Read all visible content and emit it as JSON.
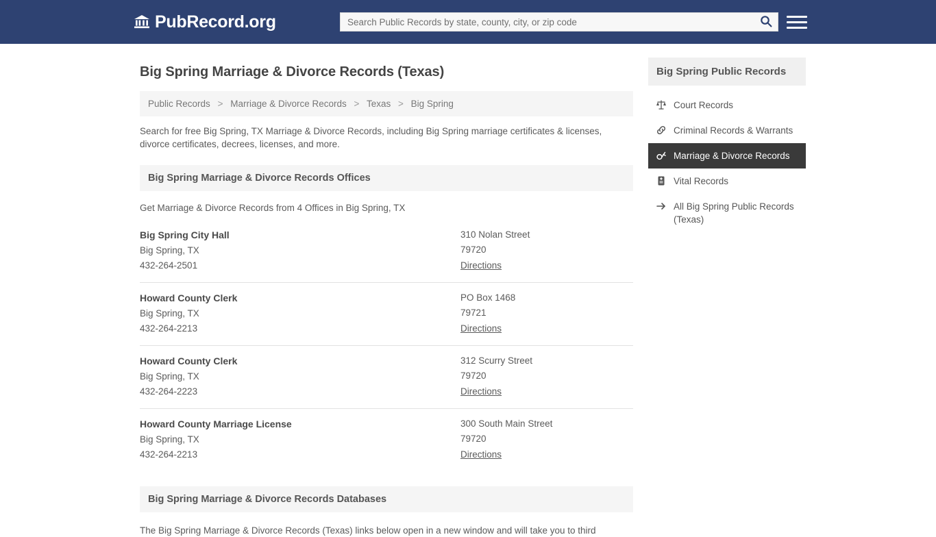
{
  "header": {
    "brand_icon": "bank-icon",
    "brand": "PubRecord.org",
    "search_placeholder": "Search Public Records by state, county, city, or zip code",
    "search_value": "",
    "search_icon": "search-icon",
    "menu_icon": "hamburger-menu-icon"
  },
  "page": {
    "title": "Big Spring Marriage & Divorce Records (Texas)"
  },
  "breadcrumb": [
    "Public Records",
    "Marriage & Divorce Records",
    "Texas",
    "Big Spring"
  ],
  "breadcrumb_separator": ">",
  "intro": "Search for free Big Spring, TX Marriage & Divorce Records, including Big Spring marriage certificates & licenses, divorce certificates, decrees, licenses, and more.",
  "offices_section": {
    "heading": "Big Spring Marriage & Divorce Records Offices",
    "subheading": "Get Marriage & Divorce Records from 4 Offices in Big Spring, TX",
    "directions_label": "Directions",
    "items": [
      {
        "name": "Big Spring City Hall",
        "city": "Big Spring, TX",
        "phone": "432-264-2501",
        "address": "310 Nolan Street",
        "zip": "79720"
      },
      {
        "name": "Howard County Clerk",
        "city": "Big Spring, TX",
        "phone": "432-264-2213",
        "address": "PO Box 1468",
        "zip": "79721"
      },
      {
        "name": "Howard County Clerk",
        "city": "Big Spring, TX",
        "phone": "432-264-2223",
        "address": "312 Scurry Street",
        "zip": "79720"
      },
      {
        "name": "Howard County Marriage License",
        "city": "Big Spring, TX",
        "phone": "432-264-2213",
        "address": "300 South Main Street",
        "zip": "79720"
      }
    ]
  },
  "databases_section": {
    "heading": "Big Spring Marriage & Divorce Records Databases",
    "text": "The Big Spring Marriage & Divorce Records (Texas) links below open in a new window and will take you to third"
  },
  "sidebar": {
    "heading": "Big Spring Public Records",
    "items": [
      {
        "label": "Court Records",
        "icon": "scales-icon",
        "active": false
      },
      {
        "label": "Criminal Records & Warrants",
        "icon": "link-icon",
        "active": false
      },
      {
        "label": "Marriage & Divorce Records",
        "icon": "rings-icon",
        "active": true
      },
      {
        "label": "Vital Records",
        "icon": "certificate-icon",
        "active": false
      },
      {
        "label": "All Big Spring Public Records (Texas)",
        "icon": "arrow-right-icon",
        "active": false
      }
    ]
  },
  "colors": {
    "header_bg": "#2e4272",
    "active_item_bg": "#3a3a3a",
    "panel_bg": "#f5f5f5"
  }
}
